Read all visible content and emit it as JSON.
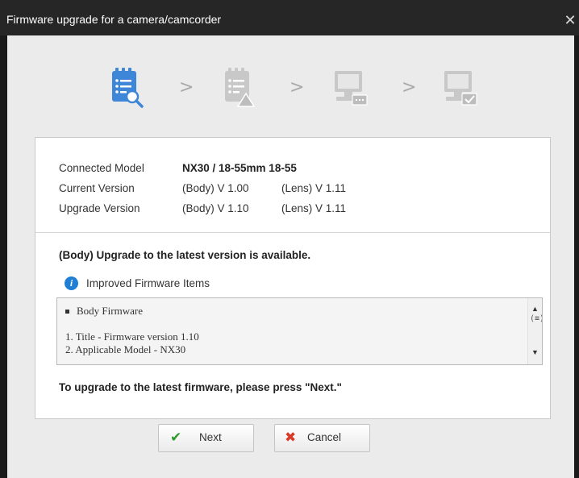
{
  "window": {
    "title": "Firmware upgrade for a camera/camcorder",
    "close_glyph": "✕"
  },
  "steps": [
    {
      "icon": "document-search-icon",
      "state": "active"
    },
    {
      "icon": "document-warning-icon",
      "state": "inactive"
    },
    {
      "icon": "computer-transfer-icon",
      "state": "inactive"
    },
    {
      "icon": "computer-check-icon",
      "state": "inactive"
    }
  ],
  "step_separator": ">",
  "colors": {
    "active_step": "#3d86d8",
    "inactive_step": "#c8c8c8",
    "info": "#1e7fd4",
    "ok": "#2e9a2e",
    "cancel": "#d83a2a"
  },
  "info": {
    "connected_model_label": "Connected Model",
    "connected_model_value": "NX30 / 18-55mm 18-55",
    "current_version_label": "Current Version",
    "current_body": "(Body) V 1.00",
    "current_lens": "(Lens) V 1.11",
    "upgrade_version_label": "Upgrade Version",
    "upgrade_body": "(Body) V 1.10",
    "upgrade_lens": "(Lens) V 1.11"
  },
  "availability_message": "(Body) Upgrade to the latest version is available.",
  "improved_items_label": "Improved Firmware Items",
  "notes": {
    "heading": "Body Firmware",
    "lines": [
      "1. Title - Firmware version 1.10",
      "2. Applicable Model - NX30"
    ]
  },
  "instruction": "To upgrade to the latest firmware, please press \"Next.\"",
  "buttons": {
    "next_label": "Next",
    "cancel_label": "Cancel"
  }
}
